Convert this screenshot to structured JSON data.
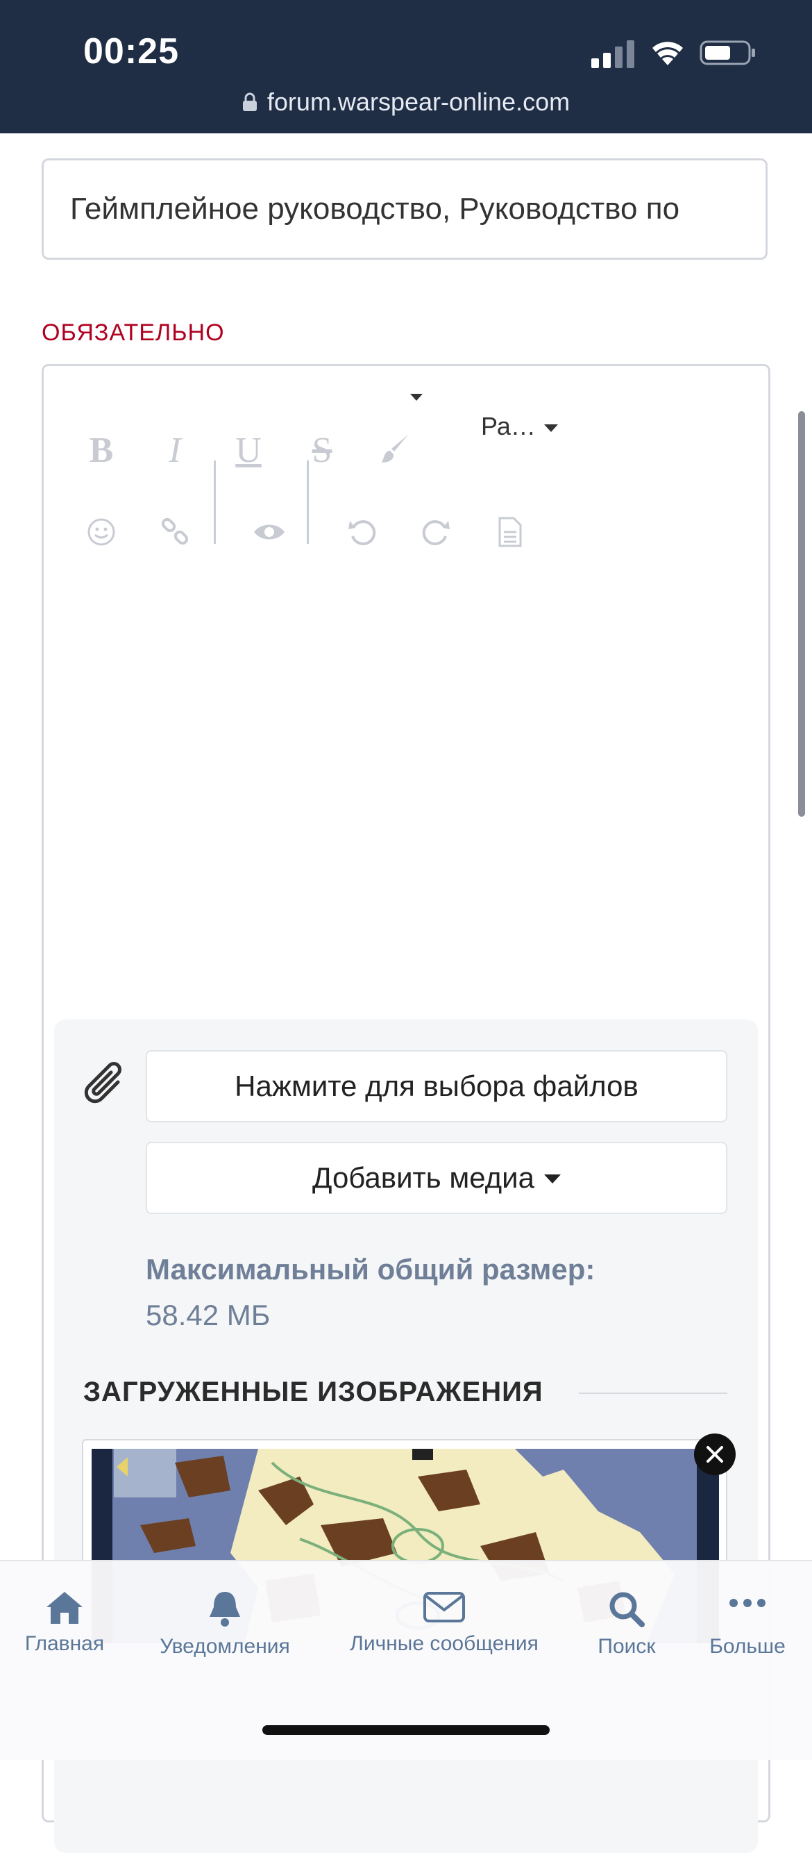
{
  "status_bar": {
    "time": "00:25",
    "url": "forum.warspear-online.com"
  },
  "form": {
    "title_value": "Геймплейное руководство, Руководство по",
    "required_label": "ОБЯЗАТЕЛЬНО"
  },
  "editor_toolbar": {
    "paragraph_select": "Ра…",
    "items": [
      "bold-icon",
      "italic-icon",
      "underline-icon",
      "strikethrough-icon",
      "brush-icon",
      "smiley-icon",
      "link-icon",
      "eye-icon",
      "undo-icon",
      "redo-icon",
      "document-icon"
    ],
    "bold_glyph": "B",
    "italic_glyph": "I",
    "underline_glyph": "U",
    "strike_glyph": "S"
  },
  "attachments": {
    "choose_files_label": "Нажмите для выбора файлов",
    "add_media_label": "Добавить медиа",
    "max_size_label": "Максимальный общий размер:",
    "max_size_value": "58.42 МБ",
    "uploaded_images_label": "ЗАГРУЖЕННЫЕ ИЗОБРАЖЕНИЯ"
  },
  "bottom_nav": {
    "items": [
      {
        "label": "Главная",
        "icon": "home-icon"
      },
      {
        "label": "Уведомления",
        "icon": "bell-icon"
      },
      {
        "label": "Личные сообщения",
        "icon": "envelope-icon"
      },
      {
        "label": "Поиск",
        "icon": "search-icon"
      },
      {
        "label": "Больше",
        "icon": "more-icon"
      }
    ]
  },
  "colors": {
    "status_bar_bg": "#1f2d45",
    "required_red": "#b00020",
    "nav_blue": "#5a7698"
  }
}
